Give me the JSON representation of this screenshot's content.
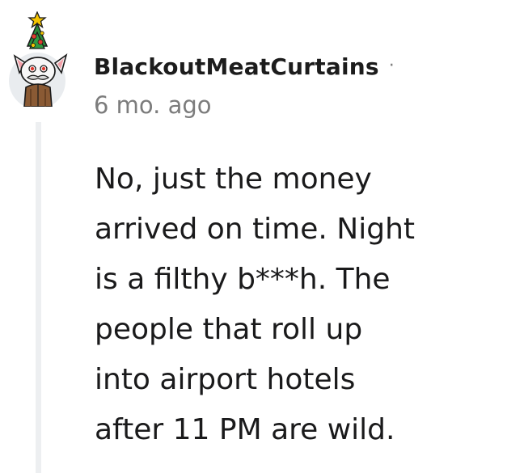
{
  "comment": {
    "author": "BlackoutMeatCurtains",
    "separator": "·",
    "timestamp": "6 mo. ago",
    "body_lines": [
      "No, just the money",
      "arrived on time. Night",
      "is a filthy b***h. The",
      "people that roll up",
      "into airport hotels",
      "after 11 PM are wild."
    ],
    "avatar": {
      "icon": "snoo-avatar-with-christmas-tree-hat-icon",
      "colors": {
        "background": "#e9ecef",
        "fur": "#f7f7f7",
        "ears": "#f2a0a8",
        "eyes": "#e23a2f",
        "mustache": "#d9d9d9",
        "body": "#8a5a34",
        "tree": "#2a8a3a",
        "star": "#f5c400",
        "ornaments": "#e23a2f"
      }
    }
  },
  "colors": {
    "username": "#1c1c1c",
    "meta": "#7c7c7c",
    "text": "#1a1a1b",
    "thread_line": "#edeff1"
  }
}
